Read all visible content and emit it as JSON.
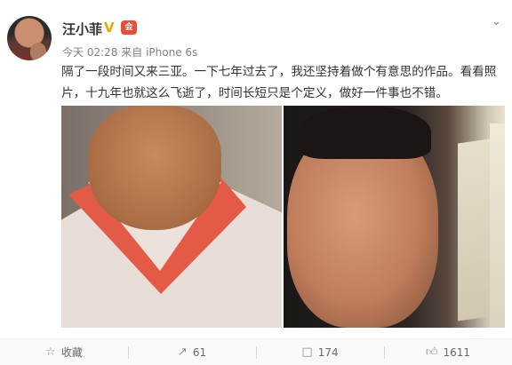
{
  "user": {
    "name": "汪小菲",
    "verified_mark": "V",
    "vip_text": "会"
  },
  "meta": {
    "time": "今天 02:28",
    "source_prefix": "来自",
    "source": "iPhone 6s"
  },
  "post": {
    "text": "隔了一段时间又来三亚。一下七年过去了，我还坚持着做个有意思的作品。看看照片，十九年也就这么飞逝了，时间长短只是个定义，做好一件事也不错。"
  },
  "actions": {
    "favorite": "收藏",
    "repost": "61",
    "comment": "174",
    "like": "1611"
  },
  "icons": {
    "menu": "chevron-down-icon",
    "favorite": "star-icon",
    "repost": "share-icon",
    "comment": "comment-icon",
    "like": "thumbs-up-icon"
  },
  "colors": {
    "verified": "#f2a400",
    "vip": "#f04a33"
  }
}
